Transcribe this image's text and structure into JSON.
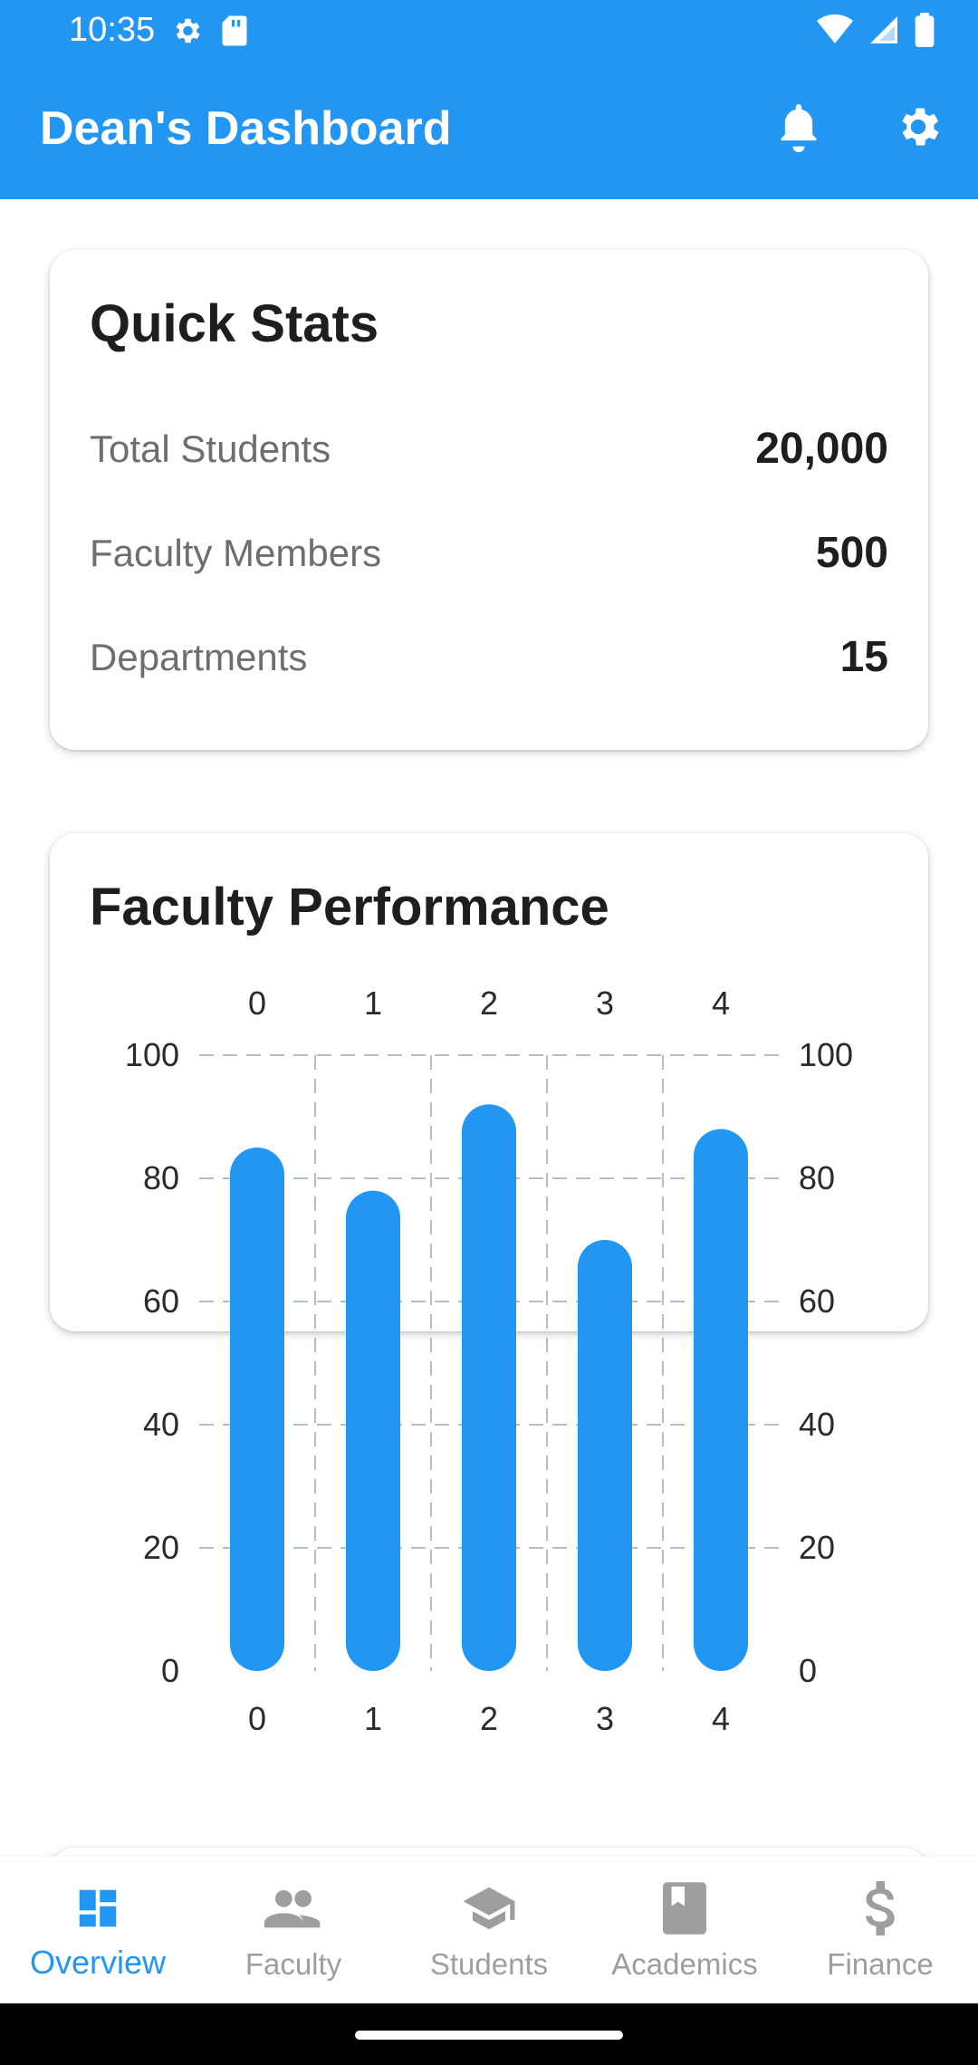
{
  "status_bar": {
    "time": "10:35",
    "icons_left": [
      "settings-icon",
      "sd-card-icon"
    ],
    "icons_right": [
      "wifi-icon",
      "signal-icon",
      "battery-icon"
    ]
  },
  "app_bar": {
    "title": "Dean's Dashboard",
    "actions": [
      "bell-icon",
      "gear-icon"
    ],
    "color": "#2196F3"
  },
  "quick_stats": {
    "title": "Quick Stats",
    "rows": [
      {
        "label": "Total Students",
        "value": "20,000"
      },
      {
        "label": "Faculty Members",
        "value": "500"
      },
      {
        "label": "Departments",
        "value": "15"
      }
    ]
  },
  "faculty_performance": {
    "title": "Faculty Performance"
  },
  "chart_data": {
    "type": "bar",
    "categories": [
      "0",
      "1",
      "2",
      "3",
      "4"
    ],
    "values": [
      85,
      78,
      92,
      70,
      88
    ],
    "ylim": [
      0,
      100
    ],
    "yticks": [
      "0",
      "20",
      "40",
      "60",
      "80",
      "100"
    ],
    "grid": true,
    "bar_color": "#2196F3",
    "title": "",
    "xlabel": "",
    "ylabel": ""
  },
  "bottom_nav": {
    "items": [
      {
        "label": "Overview",
        "icon": "dashboard-icon",
        "active": true
      },
      {
        "label": "Faculty",
        "icon": "people-icon",
        "active": false
      },
      {
        "label": "Students",
        "icon": "school-icon",
        "active": false
      },
      {
        "label": "Academics",
        "icon": "book-icon",
        "active": false
      },
      {
        "label": "Finance",
        "icon": "dollar-icon",
        "active": false
      }
    ]
  }
}
